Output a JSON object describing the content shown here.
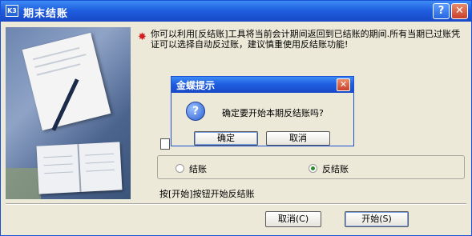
{
  "window": {
    "title": "期末结账",
    "app_icon_text": "K3",
    "help_label": "?",
    "close_label": "✕"
  },
  "notice": {
    "icon": "warning-star-icon",
    "text": "你可以利用[反结账]工具将当前会计期间返回到已结账的期间.所有当期已过账凭证可以选择自动反过账，建议慎重使用反结账功能!"
  },
  "options": {
    "radio_close": "结账",
    "radio_reverse": "反结账",
    "selected": "反结账"
  },
  "instruction": "按[开始]按钮开始反结账",
  "buttons": {
    "cancel": "取消(C)",
    "start": "开始(S)"
  },
  "dialog": {
    "title": "金蝶提示",
    "close_label": "✕",
    "question_icon": "?",
    "message": "确定要开始本期反结账吗?",
    "ok": "确定",
    "cancel": "取消"
  }
}
